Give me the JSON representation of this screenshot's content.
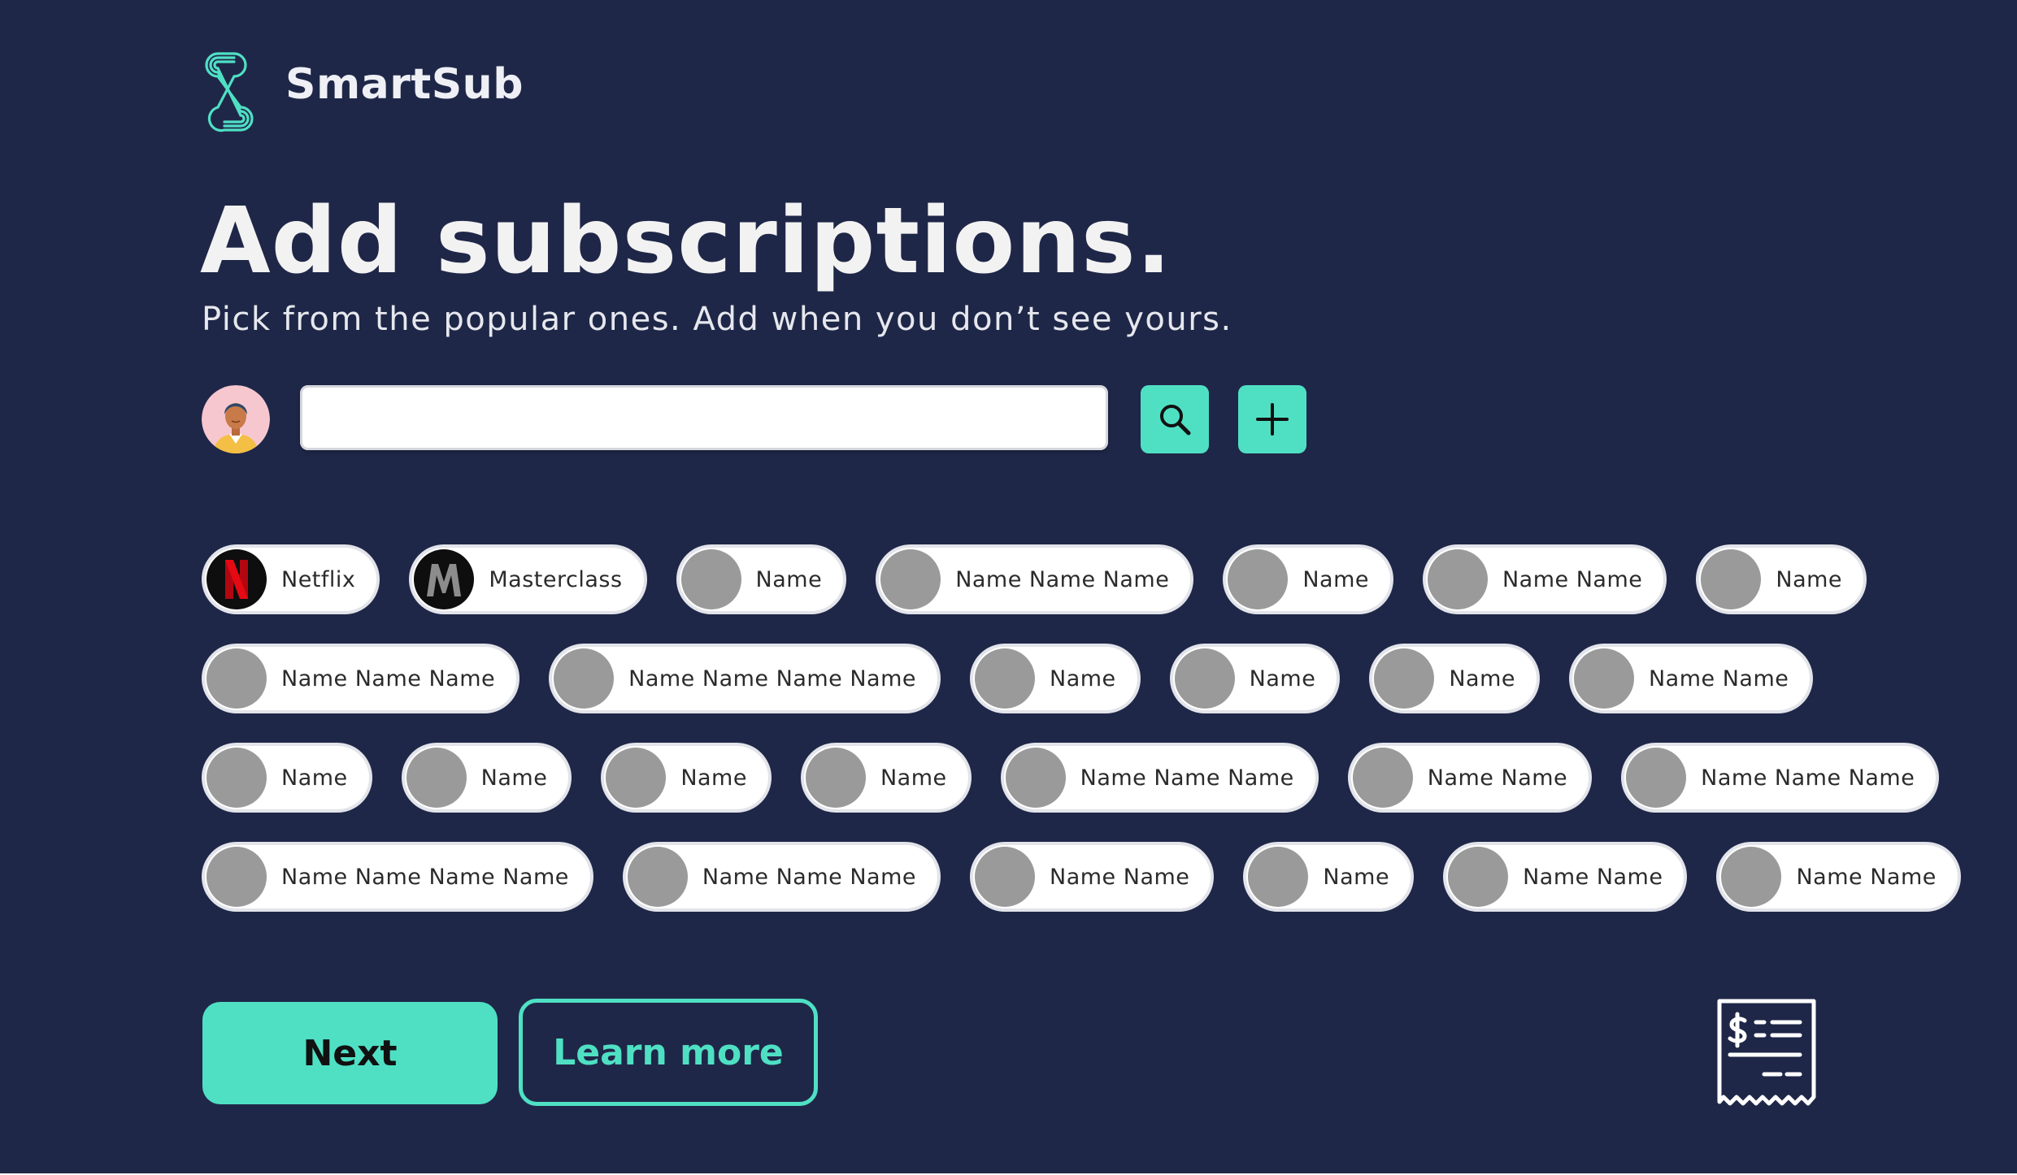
{
  "app": {
    "brand": "SmartSub"
  },
  "page": {
    "headline": "Add subscriptions.",
    "subheadline": "Pick from the popular ones. Add when you don’t see yours."
  },
  "search": {
    "value": "",
    "placeholder": ""
  },
  "icons": {
    "logo": "smartsub-logo",
    "avatar": "user-avatar",
    "search": "search-icon",
    "add": "plus-icon",
    "receipt": "receipt-icon"
  },
  "colors": {
    "background": "#1f2748",
    "accent": "#4fe0c4",
    "chip_placeholder": "#9a9a9a",
    "netflix_red": "#e50914"
  },
  "subscriptions": {
    "rows": [
      [
        {
          "label": "Netflix",
          "logo": "netflix"
        },
        {
          "label": "Masterclass",
          "logo": "masterclass"
        },
        {
          "label": "Name",
          "logo": "placeholder"
        },
        {
          "label": "Name Name Name",
          "logo": "placeholder"
        },
        {
          "label": "Name",
          "logo": "placeholder"
        },
        {
          "label": "Name Name",
          "logo": "placeholder"
        },
        {
          "label": "Name",
          "logo": "placeholder"
        }
      ],
      [
        {
          "label": "Name Name Name",
          "logo": "placeholder"
        },
        {
          "label": "Name Name Name Name",
          "logo": "placeholder"
        },
        {
          "label": "Name",
          "logo": "placeholder"
        },
        {
          "label": "Name",
          "logo": "placeholder"
        },
        {
          "label": "Name",
          "logo": "placeholder"
        },
        {
          "label": "Name Name",
          "logo": "placeholder"
        }
      ],
      [
        {
          "label": "Name",
          "logo": "placeholder"
        },
        {
          "label": "Name",
          "logo": "placeholder"
        },
        {
          "label": "Name",
          "logo": "placeholder"
        },
        {
          "label": "Name",
          "logo": "placeholder"
        },
        {
          "label": "Name Name Name",
          "logo": "placeholder"
        },
        {
          "label": "Name Name",
          "logo": "placeholder"
        },
        {
          "label": "Name Name Name",
          "logo": "placeholder"
        }
      ],
      [
        {
          "label": "Name Name Name Name",
          "logo": "placeholder"
        },
        {
          "label": "Name Name Name",
          "logo": "placeholder"
        },
        {
          "label": "Name Name",
          "logo": "placeholder"
        },
        {
          "label": "Name",
          "logo": "placeholder"
        },
        {
          "label": "Name Name",
          "logo": "placeholder"
        },
        {
          "label": "Name Name",
          "logo": "placeholder"
        }
      ]
    ]
  },
  "actions": {
    "next_label": "Next",
    "learn_more_label": "Learn more"
  }
}
